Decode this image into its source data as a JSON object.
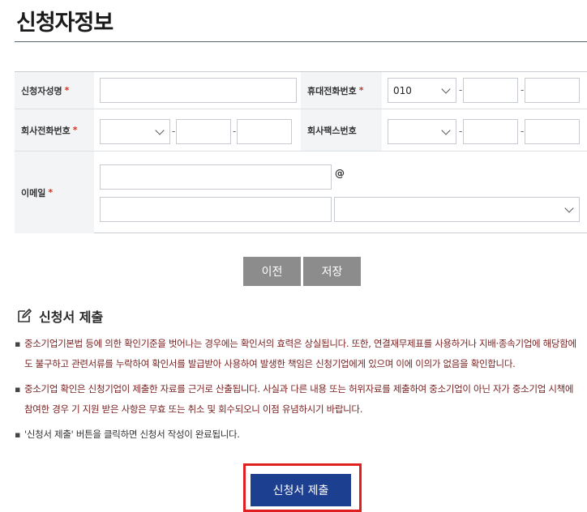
{
  "page": {
    "title": "신청자정보"
  },
  "form": {
    "required_mark": "*",
    "applicant_name_label": "신청자성명",
    "mobile_label": "휴대전화번호",
    "mobile_prefix": "010",
    "company_phone_label": "회사전화번호",
    "company_fax_label": "회사팩스번호",
    "email_label": "이메일",
    "dash": "-",
    "at_sign": "@"
  },
  "buttons": {
    "prev_label": "이전",
    "save_label": "저장",
    "submit_label": "신청서 제출"
  },
  "submission": {
    "heading": "신청서 제출",
    "notices": [
      "중소기업기본법 등에 의한 확인기준을 벗어나는 경우에는 확인서의 효력은 상실됩니다. 또한, 연결재무제표를 사용하거나 지배·종속기업에 해당함에도 불구하고 관련서류를 누락하여 확인서를 발급받아 사용하여 발생한 책임은 신청기업에게 있으며 이에 이의가 없음을 확인합니다.",
      "중소기업 확인은 신청기업이 제출한 자료를 근거로 산출됩니다. 사실과 다른 내용 또는 허위자료를 제출하여 중소기업이 아닌 자가 중소기업 시책에 참여한 경우 기 지원 받은 사항은 무효 또는 취소 및 회수되오니 이점 유념하시기 바랍니다.",
      "'신청서 제출' 버튼을 클릭하면 신청서 작성이 완료됩니다."
    ]
  },
  "colors": {
    "submit_bg": "#1d3f8f",
    "highlight_border": "#e02020",
    "notice_text": "#7a2020",
    "button_gray": "#8c8c8c"
  }
}
